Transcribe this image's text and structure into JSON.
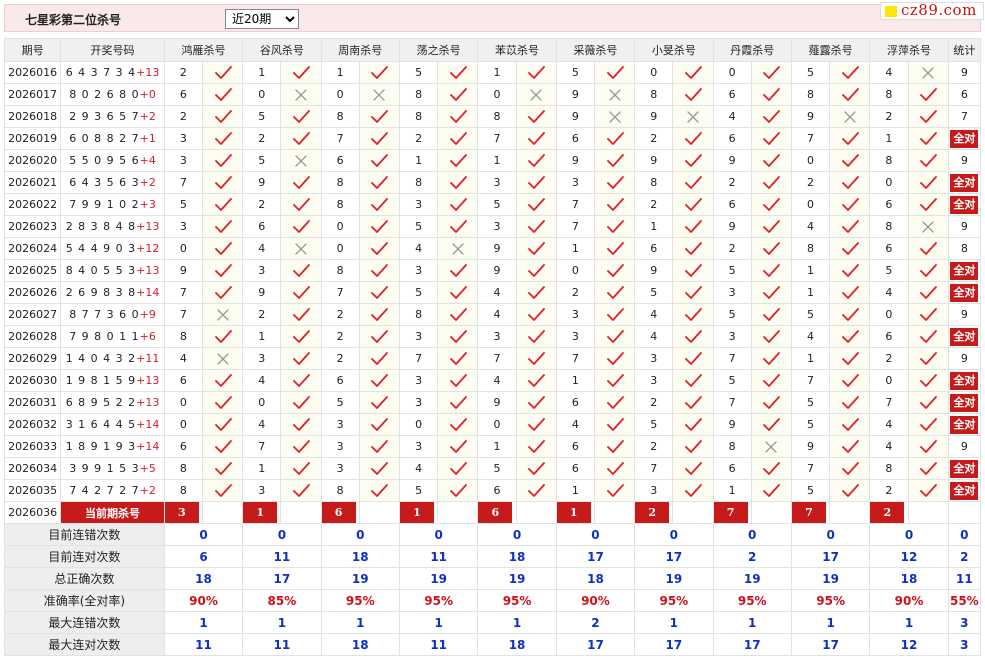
{
  "header": {
    "title": "七星彩第二位杀号",
    "period_options": [
      "近20期"
    ],
    "selected_period": "近20期"
  },
  "logo": {
    "text": "cz89.com"
  },
  "columns": [
    "期号",
    "开奖号码",
    "鸿雁杀号",
    "谷风杀号",
    "周南杀号",
    "荡之杀号",
    "苯苡杀号",
    "采薇杀号",
    "小旻杀号",
    "丹霞杀号",
    "薤露杀号",
    "浮萍杀号",
    "统计"
  ],
  "all_right_label": "全对",
  "rows": [
    {
      "period": "2026016",
      "digits": "643734",
      "special": "+13",
      "picks": [
        [
          2,
          1
        ],
        [
          1,
          1
        ],
        [
          1,
          1
        ],
        [
          5,
          1
        ],
        [
          1,
          1
        ],
        [
          5,
          1
        ],
        [
          0,
          1
        ],
        [
          0,
          1
        ],
        [
          5,
          1
        ],
        [
          4,
          0
        ]
      ],
      "stat": "9"
    },
    {
      "period": "2026017",
      "digits": "802680",
      "special": "+0",
      "picks": [
        [
          6,
          1
        ],
        [
          0,
          0
        ],
        [
          0,
          0
        ],
        [
          8,
          1
        ],
        [
          0,
          0
        ],
        [
          9,
          0
        ],
        [
          8,
          1
        ],
        [
          6,
          1
        ],
        [
          8,
          1
        ],
        [
          8,
          1
        ]
      ],
      "stat": "6"
    },
    {
      "period": "2026018",
      "digits": "293657",
      "special": "+2",
      "picks": [
        [
          2,
          1
        ],
        [
          5,
          1
        ],
        [
          8,
          1
        ],
        [
          8,
          1
        ],
        [
          8,
          1
        ],
        [
          9,
          0
        ],
        [
          9,
          0
        ],
        [
          4,
          1
        ],
        [
          9,
          0
        ],
        [
          2,
          1
        ]
      ],
      "stat": "7"
    },
    {
      "period": "2026019",
      "digits": "608827",
      "special": "+1",
      "picks": [
        [
          3,
          1
        ],
        [
          2,
          1
        ],
        [
          7,
          1
        ],
        [
          2,
          1
        ],
        [
          7,
          1
        ],
        [
          6,
          1
        ],
        [
          2,
          1
        ],
        [
          6,
          1
        ],
        [
          7,
          1
        ],
        [
          1,
          1
        ]
      ],
      "stat": "全对"
    },
    {
      "period": "2026020",
      "digits": "550956",
      "special": "+4",
      "picks": [
        [
          3,
          1
        ],
        [
          5,
          0
        ],
        [
          6,
          1
        ],
        [
          1,
          1
        ],
        [
          1,
          1
        ],
        [
          9,
          1
        ],
        [
          9,
          1
        ],
        [
          9,
          1
        ],
        [
          0,
          1
        ],
        [
          8,
          1
        ]
      ],
      "stat": "9"
    },
    {
      "period": "2026021",
      "digits": "643563",
      "special": "+2",
      "picks": [
        [
          7,
          1
        ],
        [
          9,
          1
        ],
        [
          8,
          1
        ],
        [
          8,
          1
        ],
        [
          3,
          1
        ],
        [
          3,
          1
        ],
        [
          8,
          1
        ],
        [
          2,
          1
        ],
        [
          2,
          1
        ],
        [
          0,
          1
        ]
      ],
      "stat": "全对"
    },
    {
      "period": "2026022",
      "digits": "799102",
      "special": "+3",
      "picks": [
        [
          5,
          1
        ],
        [
          2,
          1
        ],
        [
          8,
          1
        ],
        [
          3,
          1
        ],
        [
          5,
          1
        ],
        [
          7,
          1
        ],
        [
          2,
          1
        ],
        [
          6,
          1
        ],
        [
          0,
          1
        ],
        [
          6,
          1
        ]
      ],
      "stat": "全对"
    },
    {
      "period": "2026023",
      "digits": "283848",
      "special": "+13",
      "picks": [
        [
          3,
          1
        ],
        [
          6,
          1
        ],
        [
          0,
          1
        ],
        [
          5,
          1
        ],
        [
          3,
          1
        ],
        [
          7,
          1
        ],
        [
          1,
          1
        ],
        [
          9,
          1
        ],
        [
          4,
          1
        ],
        [
          8,
          0
        ]
      ],
      "stat": "9"
    },
    {
      "period": "2026024",
      "digits": "544903",
      "special": "+12",
      "picks": [
        [
          0,
          1
        ],
        [
          4,
          0
        ],
        [
          0,
          1
        ],
        [
          4,
          0
        ],
        [
          9,
          1
        ],
        [
          1,
          1
        ],
        [
          6,
          1
        ],
        [
          2,
          1
        ],
        [
          8,
          1
        ],
        [
          6,
          1
        ]
      ],
      "stat": "8"
    },
    {
      "period": "2026025",
      "digits": "840553",
      "special": "+13",
      "picks": [
        [
          9,
          1
        ],
        [
          3,
          1
        ],
        [
          8,
          1
        ],
        [
          3,
          1
        ],
        [
          9,
          1
        ],
        [
          0,
          1
        ],
        [
          9,
          1
        ],
        [
          5,
          1
        ],
        [
          1,
          1
        ],
        [
          5,
          1
        ]
      ],
      "stat": "全对"
    },
    {
      "period": "2026026",
      "digits": "269838",
      "special": "+14",
      "picks": [
        [
          7,
          1
        ],
        [
          9,
          1
        ],
        [
          7,
          1
        ],
        [
          5,
          1
        ],
        [
          4,
          1
        ],
        [
          2,
          1
        ],
        [
          5,
          1
        ],
        [
          3,
          1
        ],
        [
          1,
          1
        ],
        [
          4,
          1
        ]
      ],
      "stat": "全对"
    },
    {
      "period": "2026027",
      "digits": "877360",
      "special": "+9",
      "picks": [
        [
          7,
          0
        ],
        [
          2,
          1
        ],
        [
          2,
          1
        ],
        [
          8,
          1
        ],
        [
          4,
          1
        ],
        [
          3,
          1
        ],
        [
          4,
          1
        ],
        [
          5,
          1
        ],
        [
          5,
          1
        ],
        [
          0,
          1
        ]
      ],
      "stat": "9"
    },
    {
      "period": "2026028",
      "digits": "798011",
      "special": "+6",
      "picks": [
        [
          8,
          1
        ],
        [
          1,
          1
        ],
        [
          2,
          1
        ],
        [
          3,
          1
        ],
        [
          3,
          1
        ],
        [
          3,
          1
        ],
        [
          4,
          1
        ],
        [
          3,
          1
        ],
        [
          4,
          1
        ],
        [
          6,
          1
        ]
      ],
      "stat": "全对"
    },
    {
      "period": "2026029",
      "digits": "140432",
      "special": "+11",
      "picks": [
        [
          4,
          0
        ],
        [
          3,
          1
        ],
        [
          2,
          1
        ],
        [
          7,
          1
        ],
        [
          7,
          1
        ],
        [
          7,
          1
        ],
        [
          3,
          1
        ],
        [
          7,
          1
        ],
        [
          1,
          1
        ],
        [
          2,
          1
        ]
      ],
      "stat": "9"
    },
    {
      "period": "2026030",
      "digits": "198159",
      "special": "+13",
      "picks": [
        [
          6,
          1
        ],
        [
          4,
          1
        ],
        [
          6,
          1
        ],
        [
          3,
          1
        ],
        [
          4,
          1
        ],
        [
          1,
          1
        ],
        [
          3,
          1
        ],
        [
          5,
          1
        ],
        [
          7,
          1
        ],
        [
          0,
          1
        ]
      ],
      "stat": "全对"
    },
    {
      "period": "2026031",
      "digits": "689522",
      "special": "+13",
      "picks": [
        [
          0,
          1
        ],
        [
          0,
          1
        ],
        [
          5,
          1
        ],
        [
          3,
          1
        ],
        [
          9,
          1
        ],
        [
          6,
          1
        ],
        [
          2,
          1
        ],
        [
          7,
          1
        ],
        [
          5,
          1
        ],
        [
          7,
          1
        ]
      ],
      "stat": "全对"
    },
    {
      "period": "2026032",
      "digits": "316445",
      "special": "+14",
      "picks": [
        [
          0,
          1
        ],
        [
          4,
          1
        ],
        [
          3,
          1
        ],
        [
          0,
          1
        ],
        [
          0,
          1
        ],
        [
          4,
          1
        ],
        [
          5,
          1
        ],
        [
          9,
          1
        ],
        [
          5,
          1
        ],
        [
          4,
          1
        ]
      ],
      "stat": "全对"
    },
    {
      "period": "2026033",
      "digits": "189193",
      "special": "+14",
      "picks": [
        [
          6,
          1
        ],
        [
          7,
          1
        ],
        [
          3,
          1
        ],
        [
          3,
          1
        ],
        [
          1,
          1
        ],
        [
          6,
          1
        ],
        [
          2,
          1
        ],
        [
          8,
          0
        ],
        [
          9,
          1
        ],
        [
          4,
          1
        ]
      ],
      "stat": "9"
    },
    {
      "period": "2026034",
      "digits": "399153",
      "special": "+5",
      "picks": [
        [
          8,
          1
        ],
        [
          1,
          1
        ],
        [
          3,
          1
        ],
        [
          4,
          1
        ],
        [
          5,
          1
        ],
        [
          6,
          1
        ],
        [
          7,
          1
        ],
        [
          6,
          1
        ],
        [
          7,
          1
        ],
        [
          8,
          1
        ]
      ],
      "stat": "全对"
    },
    {
      "period": "2026035",
      "digits": "742727",
      "special": "+2",
      "picks": [
        [
          8,
          1
        ],
        [
          3,
          1
        ],
        [
          8,
          1
        ],
        [
          5,
          1
        ],
        [
          6,
          1
        ],
        [
          1,
          1
        ],
        [
          3,
          1
        ],
        [
          1,
          1
        ],
        [
          5,
          1
        ],
        [
          2,
          1
        ]
      ],
      "stat": "全对"
    }
  ],
  "current": {
    "period": "2026036",
    "label": "当前期杀号",
    "picks": [
      "3",
      "1",
      "6",
      "1",
      "6",
      "1",
      "2",
      "7",
      "7",
      "2"
    ]
  },
  "summary": [
    {
      "label": "目前连错次数",
      "values": [
        "0",
        "0",
        "0",
        "0",
        "0",
        "0",
        "0",
        "0",
        "0",
        "0",
        "0"
      ],
      "red": false
    },
    {
      "label": "目前连对次数",
      "values": [
        "6",
        "11",
        "18",
        "11",
        "18",
        "17",
        "17",
        "2",
        "17",
        "12",
        "2"
      ],
      "red": false
    },
    {
      "label": "总正确次数",
      "values": [
        "18",
        "17",
        "19",
        "19",
        "19",
        "18",
        "19",
        "19",
        "19",
        "18",
        "11"
      ],
      "red": false
    },
    {
      "label": "准确率(全对率)",
      "values": [
        "90%",
        "85%",
        "95%",
        "95%",
        "95%",
        "90%",
        "95%",
        "95%",
        "95%",
        "90%",
        "55%"
      ],
      "red": true
    },
    {
      "label": "最大连错次数",
      "values": [
        "1",
        "1",
        "1",
        "1",
        "1",
        "2",
        "1",
        "1",
        "1",
        "1",
        "3"
      ],
      "red": false
    },
    {
      "label": "最大连对次数",
      "values": [
        "11",
        "11",
        "18",
        "11",
        "18",
        "17",
        "17",
        "17",
        "17",
        "12",
        "3"
      ],
      "red": false
    }
  ],
  "colors": {
    "accent_red": "#c61b1b",
    "check": "#e0202a",
    "cross": "#999999",
    "stat_blue": "#1030c0"
  }
}
